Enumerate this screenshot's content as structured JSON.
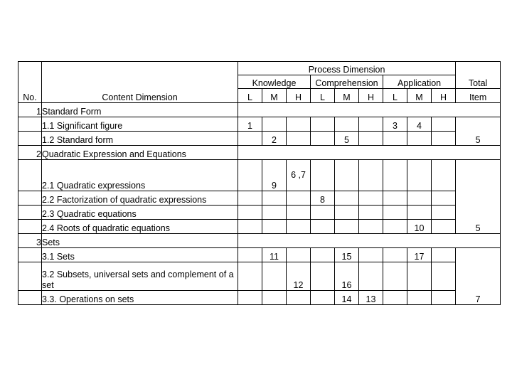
{
  "table": {
    "headers": {
      "no": "No.",
      "content_dimension": "Content Dimension",
      "process_dimension": "Process Dimension",
      "groups": [
        "Knowledge",
        "Comprehension",
        "Application"
      ],
      "levels": [
        "L",
        "M",
        "H",
        "L",
        "M",
        "H",
        "L",
        "M",
        "H"
      ],
      "total_line1": "Total",
      "total_line2": "Item"
    },
    "sections": [
      {
        "no": "1",
        "title": "Standard Form",
        "total": "5",
        "rows": [
          {
            "label": "1.1 Significant figure",
            "cells": [
              "1",
              "",
              "",
              "",
              "",
              "",
              "3",
              "4",
              ""
            ]
          },
          {
            "label": "1.2 Standard form",
            "cells": [
              "",
              "2",
              "",
              "",
              "5",
              "",
              "",
              "",
              ""
            ]
          }
        ]
      },
      {
        "no": "2",
        "title": "Quadratic Expression and Equations",
        "total": "5",
        "rows": [
          {
            "label": "2.1 Quadratic expressions",
            "cells": [
              "",
              "9",
              "6 ,7",
              "",
              "",
              "",
              "",
              "",
              ""
            ]
          },
          {
            "label": "2.2 Factorization of quadratic expressions",
            "cells": [
              "",
              "",
              "",
              "8",
              "",
              "",
              "",
              "",
              ""
            ]
          },
          {
            "label": "2.3 Quadratic equations",
            "cells": [
              "",
              "",
              "",
              "",
              "",
              "",
              "",
              "",
              ""
            ]
          },
          {
            "label": "2.4 Roots of quadratic equations",
            "cells": [
              "",
              "",
              "",
              "",
              "",
              "",
              "",
              "10",
              ""
            ]
          }
        ]
      },
      {
        "no": "3",
        "title": "Sets",
        "total": "7",
        "rows": [
          {
            "label": "3.1 Sets",
            "cells": [
              "",
              "11",
              "",
              "",
              "15",
              "",
              "",
              "17",
              ""
            ]
          },
          {
            "label": "3.2 Subsets, universal sets and complement of a set",
            "cells": [
              "",
              "",
              "12",
              "",
              "16",
              "",
              "",
              "",
              ""
            ]
          },
          {
            "label": "3.3. Operations on sets",
            "cells": [
              "",
              "",
              "",
              "",
              "14",
              "13",
              "",
              "",
              ""
            ]
          }
        ]
      }
    ]
  },
  "colors": {
    "border": "#000000",
    "section_fill": "#000000",
    "background": "#ffffff",
    "text": "#000000"
  }
}
